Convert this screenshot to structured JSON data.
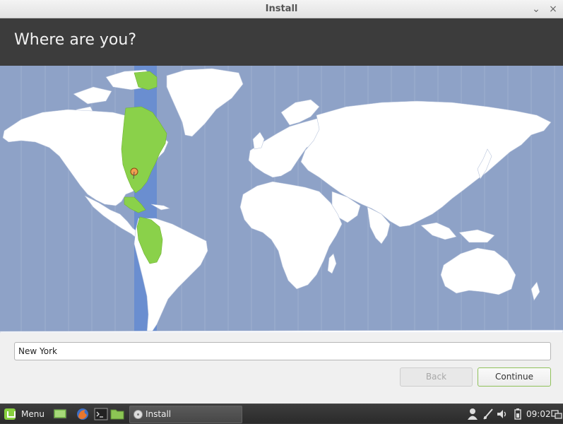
{
  "window": {
    "title": "Install",
    "minimize_glyph": "⌄",
    "close_glyph": "×"
  },
  "page": {
    "heading": "Where are you?"
  },
  "map": {
    "selected_zone": "America/New_York"
  },
  "location": {
    "value": "New York"
  },
  "buttons": {
    "back": "Back",
    "continue": "Continue"
  },
  "taskbar": {
    "menu_label": "Menu",
    "task_label": "Install",
    "clock": "09:02",
    "launchers": [
      "desktop-icon",
      "firefox-icon",
      "terminal-icon",
      "files-icon"
    ],
    "tray": [
      "user-icon",
      "network-icon",
      "volume-icon",
      "battery-icon",
      "workspace-icon"
    ]
  },
  "colors": {
    "ocean": "#8ea2c7",
    "land": "#ffffff",
    "selected_land": "#8ad14a",
    "zone_band": "#6a8ed0",
    "header": "#3c3c3c",
    "accent": "#8fc15a"
  }
}
